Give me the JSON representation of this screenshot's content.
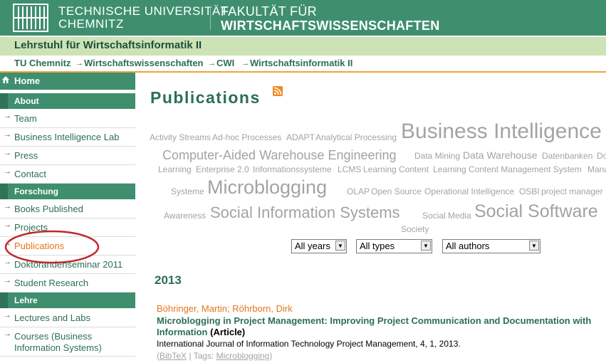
{
  "header": {
    "university_line1": "TECHNISCHE UNIVERSITÄT",
    "university_line2": "CHEMNITZ",
    "faculty_line1": "FAKULTÄT FÜR",
    "faculty_line2": "WIRTSCHAFTSWISSENSCHAFTEN",
    "accent": "#3f8f6f"
  },
  "chair": {
    "title": "Lehrstuhl für Wirtschaftsinformatik II",
    "bg": "#cde3b6"
  },
  "breadcrumb": [
    "TU Chemnitz",
    "Wirtschaftswissenschaften",
    "CWI",
    "Wirtschaftsinformatik II"
  ],
  "sidebar": {
    "home": "Home",
    "sections": [
      {
        "label": "About",
        "items": [
          "Team",
          "Business Intelligence Lab",
          "Press",
          "Contact"
        ]
      },
      {
        "label": "Forschung",
        "items": [
          "Books Published",
          "Projects",
          "Publications",
          "Doktorandenseminar 2011",
          "Student Research"
        ]
      },
      {
        "label": "Lehre",
        "items": [
          "Lectures and Labs",
          "Courses (Business Information Systems)"
        ]
      }
    ],
    "active_item": "Publications"
  },
  "page": {
    "title": "Publications",
    "rss_icon": "rss-icon"
  },
  "tag_cloud": [
    "Activity Streams",
    "Ad-hoc Processes",
    "ADAPT",
    "Analytical Processing",
    "Business Intelligence",
    "Computer-Aided Warehouse Engineering",
    "Data Mining",
    "Data Warehouse",
    "Datenbanken",
    "Do",
    "Learning",
    "Enterprise 2.0",
    "Informationssysteme",
    "LCMS",
    "Learning Content",
    "Learning Content Management System",
    "Mana",
    "Systeme",
    "Microblogging",
    "OLAP",
    "Open Source",
    "Operational Intelligence",
    "OSBI",
    "project manager",
    "Awareness",
    "Social Information Systems",
    "Social Media",
    "Social Software",
    "Society"
  ],
  "filters": {
    "year": "All years",
    "type": "All types",
    "author": "All authors"
  },
  "publications": {
    "year": "2013",
    "entries": [
      {
        "authors": "Böhringer, Martin; Röhrborn, Dirk",
        "title_line1": "Microblogging in Project Management: Improving Project Communication and Documentation with",
        "title_line2": "Information",
        "type": "(Article)",
        "venue": "International Journal of Information Technology Project Management, 4, 1, 2013.",
        "bibtex": "BibTeX",
        "tags_label": "Tags:",
        "tag": "Microblogging"
      }
    ]
  }
}
